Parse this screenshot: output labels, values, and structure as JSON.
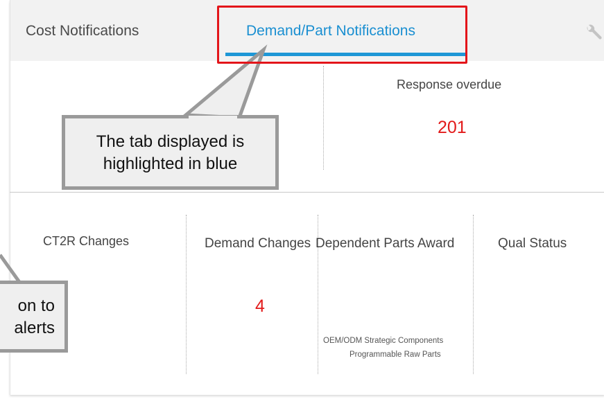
{
  "tabs": {
    "cost_label": "Cost Notifications",
    "demand_label": "Demand/Part Notifications"
  },
  "icons": {
    "settings": "wrench-icon"
  },
  "top_section": {
    "response_overdue": {
      "label": "Response overdue",
      "value": "201"
    }
  },
  "bottom_section": {
    "ct2r": {
      "label": "CT2R Changes"
    },
    "demand_changes": {
      "label": "Demand Changes",
      "value": "4"
    },
    "dependent_parts": {
      "label": "Dependent Parts Award",
      "sub1": "OEM/ODM Strategic Components",
      "sub2": "Programmable Raw Parts"
    },
    "qual_status": {
      "label": "Qual Status"
    }
  },
  "callouts": {
    "tab_callout_line1": "The tab displayed is",
    "tab_callout_line2": "highlighted in blue",
    "left_callout_line1": "on to",
    "left_callout_line2": "alerts"
  },
  "colors": {
    "active_tab": "#1a8fd1",
    "alert_value": "#e21a1a",
    "highlight": "#e3151a"
  }
}
